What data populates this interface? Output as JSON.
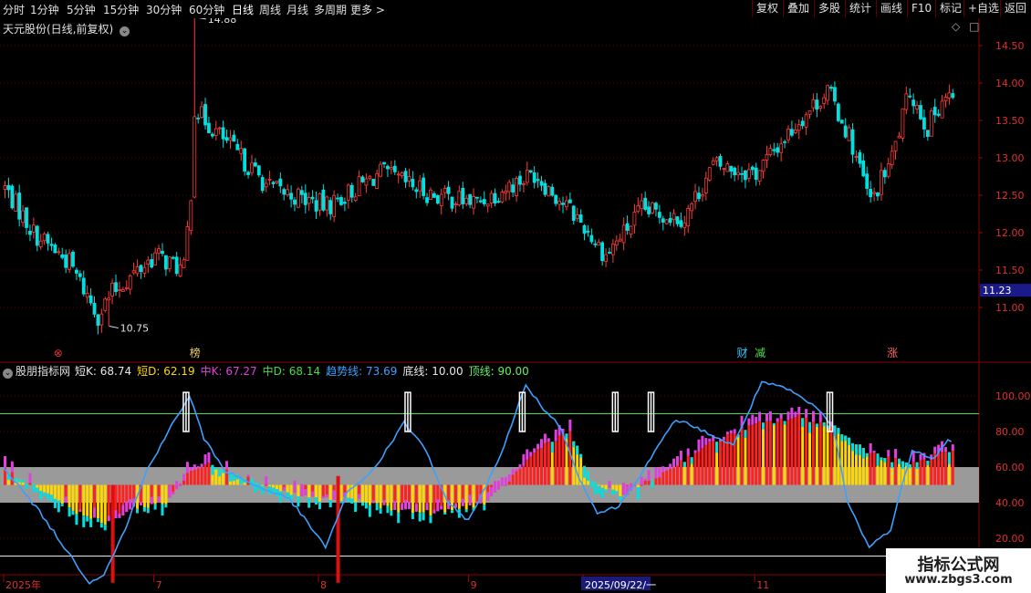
{
  "toolbar": {
    "periods": [
      "分时",
      "1分钟",
      "5分钟",
      "15分钟",
      "30分钟",
      "60分钟",
      "日线",
      "周线",
      "月线",
      "多周期",
      "更多"
    ],
    "selected": "日线",
    "more_arrow": ">",
    "right_buttons": [
      "复权",
      "叠加",
      "多股",
      "统计",
      "画线",
      "F10",
      "标记",
      "+自选",
      "返回"
    ]
  },
  "main_panel": {
    "title": "天元股份(日线,前复权)",
    "price_axis_labels": [
      "14.50",
      "14.00",
      "13.50",
      "13.00",
      "12.50",
      "12.00",
      "11.50",
      "11.00"
    ],
    "current_price": "11.23",
    "high_label": "14.88",
    "low_label": "10.75",
    "event_markers": [
      {
        "text": "⊗",
        "idx": 15,
        "color": "#e53535"
      },
      {
        "text": "榜",
        "idx": 53,
        "color": "#f0d060"
      },
      {
        "text": "财",
        "idx": 206,
        "color": "#40c8ff"
      },
      {
        "text": "减",
        "idx": 211,
        "color": "#55dd55"
      },
      {
        "text": "涨",
        "idx": 248,
        "color": "#ff6060"
      }
    ]
  },
  "indicator_panel": {
    "name": "股朋指标网",
    "legend": [
      {
        "label": "短K:",
        "value": "68.74",
        "color": "#e8e8e8"
      },
      {
        "label": "短D:",
        "value": "62.19",
        "color": "#ffd700"
      },
      {
        "label": "中K:",
        "value": "67.27",
        "color": "#e040e0"
      },
      {
        "label": "中D:",
        "value": "68.14",
        "color": "#44dd44"
      },
      {
        "label": "趋势线:",
        "value": "73.69",
        "color": "#3ca0ff"
      },
      {
        "label": "底线:",
        "value": "10.00",
        "color": "#e8e8e8"
      },
      {
        "label": "顶线:",
        "value": "90.00",
        "color": "#66ee66"
      }
    ],
    "axis_labels": [
      "100.00",
      "80.00",
      "60.00",
      "40.00",
      "20.00"
    ]
  },
  "date_axis": [
    {
      "label": "2025年",
      "idx": 0
    },
    {
      "label": "7",
      "idx": 42
    },
    {
      "label": "8",
      "idx": 88
    },
    {
      "label": "9",
      "idx": 130
    },
    {
      "label": "2025/09/22/一",
      "idx": 162,
      "highlight": true
    },
    {
      "label": "11",
      "idx": 210
    }
  ],
  "watermark": {
    "line1": "指标公式网",
    "line2": "www.zbgs3.com"
  },
  "colors": {
    "up": "#ff3c3c",
    "down": "#00e0e0",
    "grid": "#5a0000",
    "osc_up": "#ff2020",
    "osc_down": "#ffd700",
    "osc_up2": "#e040e0",
    "osc_down2": "#00e0e0",
    "trend": "#3ca0ff"
  },
  "chart_data": {
    "type": "candlestick",
    "price_range": [
      10.7,
      14.9
    ],
    "price_keypoints": [
      [
        0,
        12.6
      ],
      [
        8,
        12.0
      ],
      [
        18,
        11.6
      ],
      [
        26,
        10.9
      ],
      [
        30,
        11.2
      ],
      [
        42,
        11.7
      ],
      [
        50,
        11.5
      ],
      [
        54,
        13.6
      ],
      [
        60,
        13.3
      ],
      [
        66,
        13.0
      ],
      [
        74,
        12.6
      ],
      [
        90,
        12.35
      ],
      [
        105,
        12.8
      ],
      [
        120,
        12.5
      ],
      [
        132,
        12.4
      ],
      [
        148,
        12.8
      ],
      [
        160,
        12.2
      ],
      [
        168,
        11.7
      ],
      [
        178,
        12.3
      ],
      [
        190,
        12.2
      ],
      [
        198,
        12.9
      ],
      [
        210,
        12.8
      ],
      [
        222,
        13.5
      ],
      [
        230,
        13.9
      ],
      [
        236,
        13.3
      ],
      [
        242,
        12.4
      ],
      [
        248,
        13.0
      ],
      [
        253,
        13.9
      ],
      [
        258,
        13.4
      ],
      [
        262,
        13.8
      ]
    ],
    "overlap_zone": [
      40,
      60
    ],
    "bottom_line": 10,
    "top_line": 90,
    "osc_keypoints": [
      [
        0,
        58
      ],
      [
        10,
        48
      ],
      [
        20,
        35
      ],
      [
        28,
        28
      ],
      [
        36,
        37
      ],
      [
        45,
        40
      ],
      [
        52,
        58
      ],
      [
        58,
        62
      ],
      [
        70,
        52
      ],
      [
        80,
        45
      ],
      [
        88,
        42
      ],
      [
        96,
        42
      ],
      [
        110,
        36
      ],
      [
        120,
        34
      ],
      [
        135,
        40
      ],
      [
        150,
        72
      ],
      [
        158,
        80
      ],
      [
        164,
        52
      ],
      [
        172,
        44
      ],
      [
        182,
        54
      ],
      [
        196,
        72
      ],
      [
        210,
        84
      ],
      [
        222,
        88
      ],
      [
        232,
        83
      ],
      [
        240,
        70
      ],
      [
        248,
        64
      ],
      [
        255,
        62
      ],
      [
        262,
        68
      ]
    ],
    "trend_keypoints": [
      [
        0,
        60
      ],
      [
        10,
        35
      ],
      [
        18,
        12
      ],
      [
        24,
        -5
      ],
      [
        28,
        0
      ],
      [
        34,
        25
      ],
      [
        40,
        58
      ],
      [
        46,
        80
      ],
      [
        52,
        100
      ],
      [
        56,
        76
      ],
      [
        62,
        58
      ],
      [
        70,
        50
      ],
      [
        80,
        42
      ],
      [
        90,
        15
      ],
      [
        96,
        45
      ],
      [
        104,
        60
      ],
      [
        112,
        85
      ],
      [
        118,
        70
      ],
      [
        124,
        40
      ],
      [
        130,
        30
      ],
      [
        138,
        62
      ],
      [
        146,
        106
      ],
      [
        150,
        95
      ],
      [
        156,
        82
      ],
      [
        160,
        58
      ],
      [
        166,
        34
      ],
      [
        172,
        38
      ],
      [
        180,
        62
      ],
      [
        188,
        87
      ],
      [
        196,
        80
      ],
      [
        204,
        72
      ],
      [
        212,
        108
      ],
      [
        220,
        103
      ],
      [
        228,
        92
      ],
      [
        232,
        82
      ],
      [
        236,
        40
      ],
      [
        242,
        15
      ],
      [
        248,
        25
      ],
      [
        254,
        70
      ],
      [
        260,
        65
      ],
      [
        264,
        75
      ]
    ],
    "signal_bars": [
      51,
      113,
      145,
      171,
      181,
      231
    ]
  }
}
